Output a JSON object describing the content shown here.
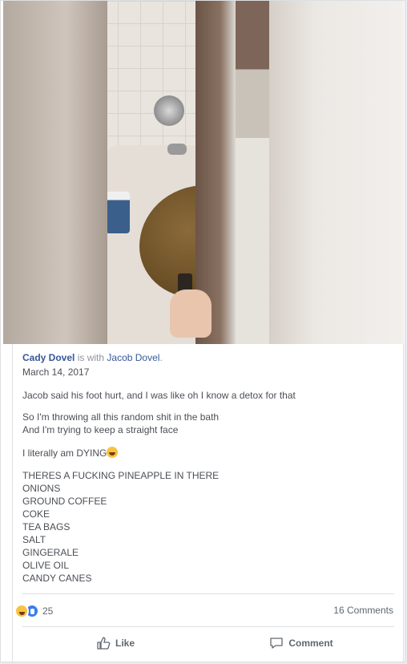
{
  "post": {
    "author": "Cady Dovel",
    "with_text": "is with",
    "tagged": "Jacob Dovel",
    "tagged_suffix": ".",
    "date": "March 14, 2017",
    "line1": "Jacob said his foot hurt, and I was like oh I know a detox for that",
    "line2a": "So I'm throwing all this random shit in the bath",
    "line2b": "And I'm trying to keep a straight face",
    "line3": "I literally am DYING",
    "list": [
      "THERES A FUCKING PINEAPPLE IN THERE",
      "ONIONS",
      "GROUND COFFEE",
      "COKE",
      "TEA BAGS",
      "SALT",
      "GINGERALE",
      "OLIVE OIL",
      "CANDY CANES"
    ]
  },
  "stats": {
    "reaction_count": "25",
    "comments": "16 Comments",
    "reaction_icons": [
      "haha-icon",
      "like-icon"
    ]
  },
  "actions": {
    "like": "Like",
    "comment": "Comment"
  },
  "colors": {
    "link": "#365899",
    "muted": "#90949c",
    "body_text": "#4b4f56",
    "like_blue": "#3b7bf0",
    "haha_yellow": "#f7c340"
  }
}
